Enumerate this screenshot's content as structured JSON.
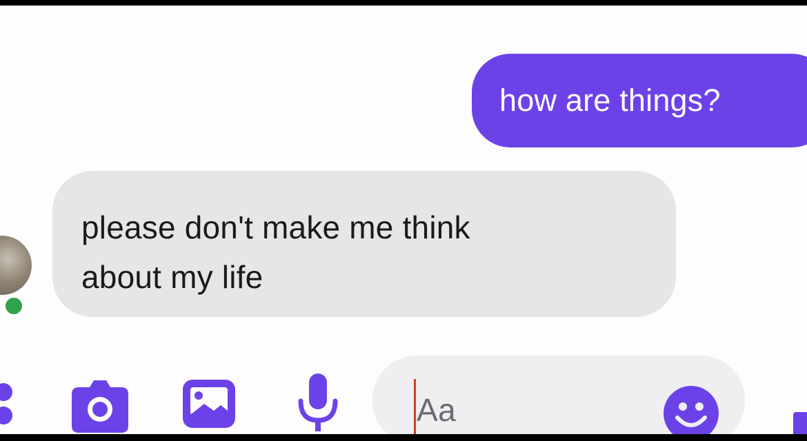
{
  "conversation": {
    "messages": [
      {
        "direction": "outgoing",
        "text": "how are things?"
      },
      {
        "direction": "incoming",
        "lines": [
          "please don't make me think",
          "about my life"
        ]
      }
    ]
  },
  "composer": {
    "placeholder": "Aa",
    "icons": [
      "more-icon",
      "camera-icon",
      "image-icon",
      "mic-icon",
      "emoji-icon",
      "like-icon"
    ]
  },
  "colors": {
    "accent": "#6c42e8",
    "incoming_bubble": "#e6e6e9",
    "presence": "#31a24c"
  }
}
